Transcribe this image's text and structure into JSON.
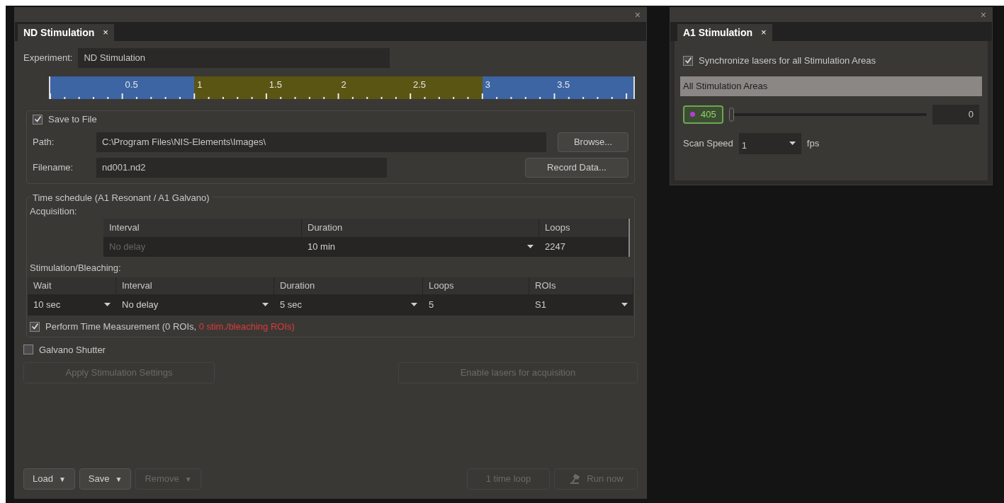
{
  "nd_panel": {
    "close": "×",
    "tab": {
      "label": "ND Stimulation",
      "close": "×",
      "selected": true
    },
    "experiment": {
      "label": "Experiment:",
      "value": "ND Stimulation"
    },
    "timeline": {
      "labels": [
        "0.5",
        "1",
        "1.5",
        "2",
        "2.5",
        "3",
        "3.5"
      ],
      "segments": [
        {
          "color": "#3d64a3",
          "level": 0.247
        },
        {
          "color": "#5a5512",
          "level": 0.494
        },
        {
          "color": "#3d64a3",
          "level": 0.259
        }
      ]
    },
    "save": {
      "label": "Save to File",
      "checked": true,
      "path_label": "Path:",
      "path": "C:\\Program Files\\NIS-Elements\\Images\\",
      "browse": "Browse...",
      "filename_label": "Filename:",
      "filename": "nd001.nd2",
      "record": "Record Data..."
    },
    "schedule": {
      "title": "Time schedule (A1 Resonant / A1 Galvano)",
      "acq_label": "Acquisition:",
      "acq_columns": [
        "Interval",
        "Duration",
        "Loops"
      ],
      "acq_row": [
        {
          "text": "No delay",
          "disabled": true,
          "dropdown": false
        },
        {
          "text": "10 min",
          "disabled": false,
          "dropdown": true
        },
        {
          "text": "2247",
          "disabled": false,
          "dropdown": false
        }
      ],
      "stim_label": "Stimulation/Bleaching:",
      "stim_columns": [
        "Wait",
        "Interval",
        "Duration",
        "Loops",
        "ROIs"
      ],
      "stim_row": [
        {
          "text": "10 sec",
          "dropdown": true
        },
        {
          "text": "No delay",
          "dropdown": true
        },
        {
          "text": "5 sec",
          "dropdown": true
        },
        {
          "text": "5",
          "dropdown": false
        },
        {
          "text": "S1",
          "dropdown": true
        }
      ],
      "measure": {
        "checked": true,
        "text": "Perform Time Measurement (0 ROIs, ",
        "warning": "0 stim./bleaching ROIs)"
      }
    },
    "galvano": {
      "label": "Galvano Shutter",
      "checked": false
    },
    "apply": {
      "label": "Apply Stimulation Settings",
      "disabled": true
    },
    "enable": {
      "label": "Enable lasers for acquisition",
      "disabled": true
    },
    "bottom": [
      {
        "label": "Load",
        "caret": "▼",
        "disabled": false
      },
      {
        "label": "Save",
        "caret": "▼",
        "disabled": false
      },
      {
        "label": "Remove",
        "caret": "▼",
        "disabled": true
      }
    ],
    "loop": {
      "label": "1 time loop",
      "disabled": true
    },
    "run": {
      "label": "Run now",
      "disabled": true
    }
  },
  "a1_panel": {
    "close": "×",
    "tab": {
      "label": "A1 Stimulation",
      "close": "×",
      "selected": true
    },
    "sync": {
      "label": "Synchronize lasers for all Stimulation Areas",
      "checked": true
    },
    "areas": "All Stimulation Areas",
    "laser": {
      "label": "405",
      "color": "#b040d0",
      "on": true,
      "level": 0,
      "value": "0"
    },
    "scan": {
      "label": "Scan Speed",
      "value": "1",
      "unit": "fps"
    }
  }
}
